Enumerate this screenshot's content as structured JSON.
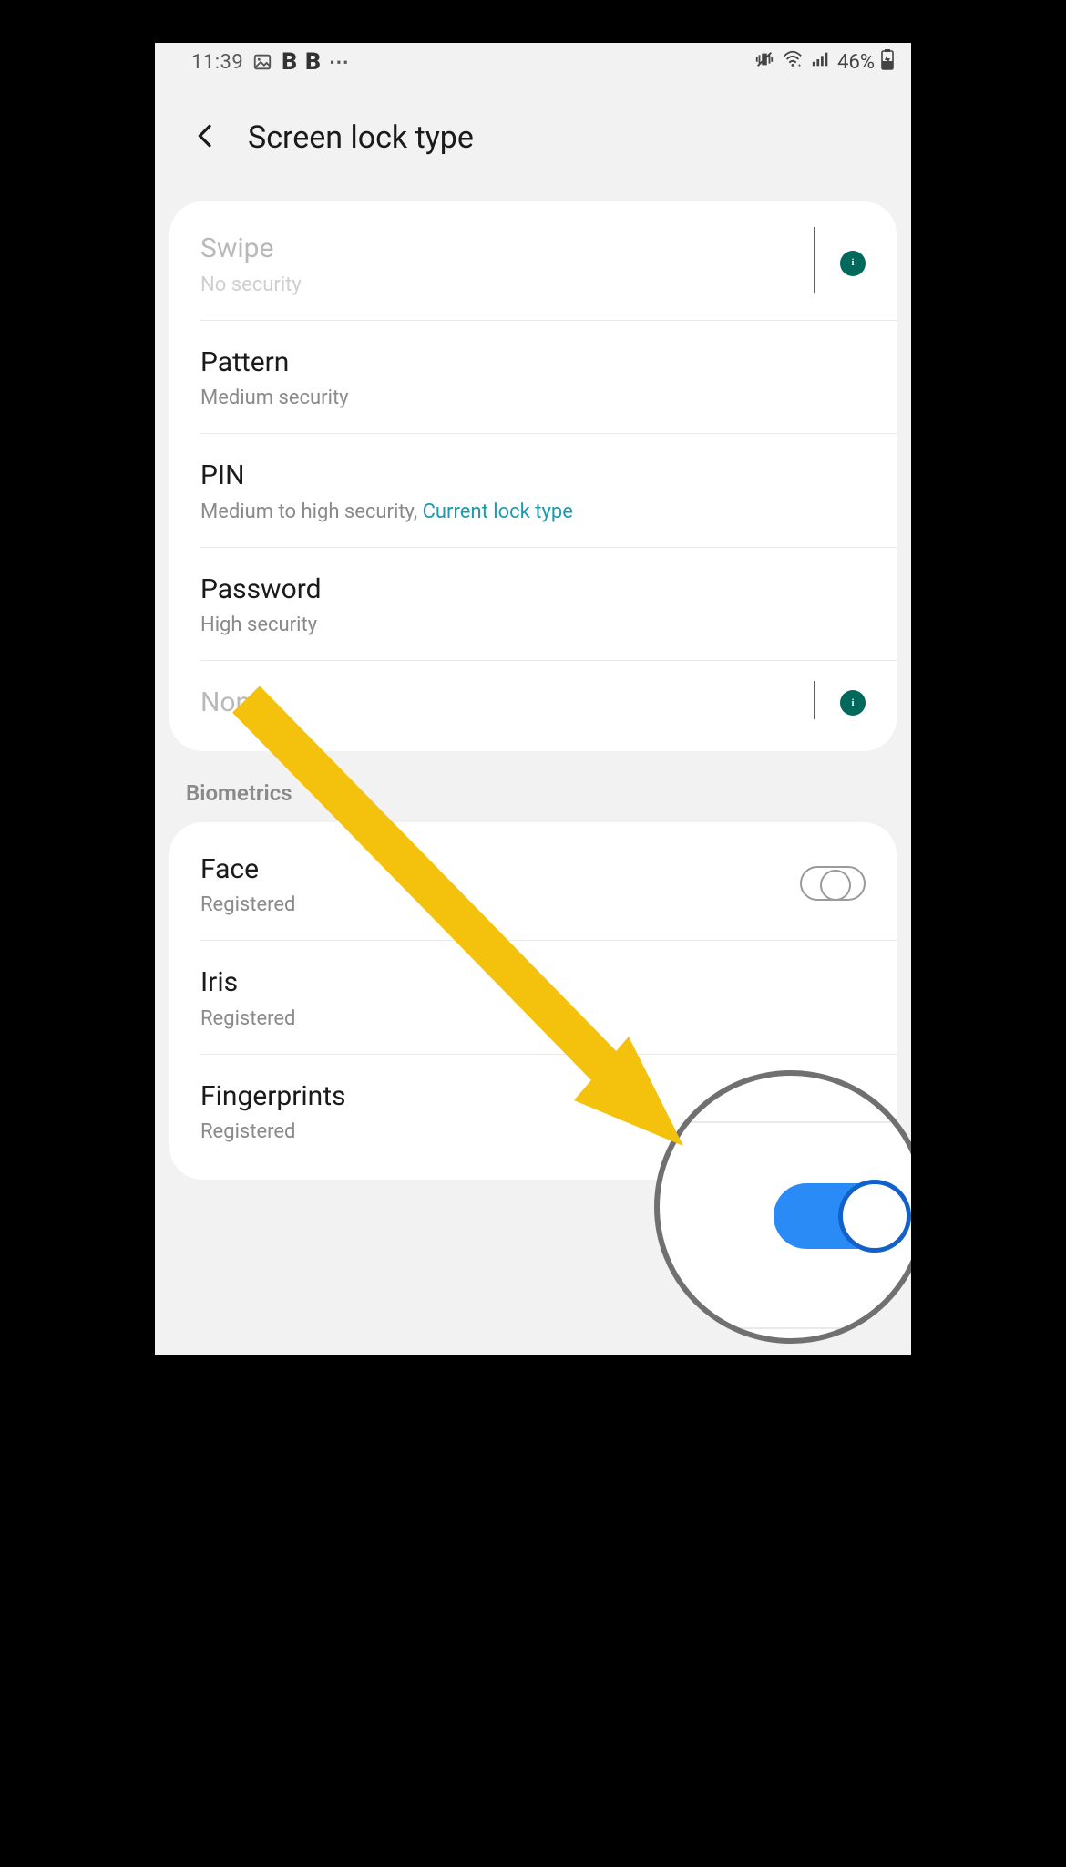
{
  "status": {
    "time": "11:39",
    "battery_pct": "46%"
  },
  "header": {
    "title": "Screen lock type"
  },
  "lock_types": {
    "swipe": {
      "title": "Swipe",
      "sub": "No security"
    },
    "pattern": {
      "title": "Pattern",
      "sub": "Medium security"
    },
    "pin": {
      "title": "PIN",
      "sub_prefix": "Medium to high security, ",
      "sub_current": "Current lock type"
    },
    "password": {
      "title": "Password",
      "sub": "High security"
    },
    "none": {
      "title": "None"
    }
  },
  "sections": {
    "biometrics": "Biometrics"
  },
  "biometrics": {
    "face": {
      "title": "Face",
      "sub": "Registered"
    },
    "iris": {
      "title": "Iris",
      "sub": "Registered"
    },
    "fingerprints": {
      "title": "Fingerprints",
      "sub": "Registered"
    }
  }
}
